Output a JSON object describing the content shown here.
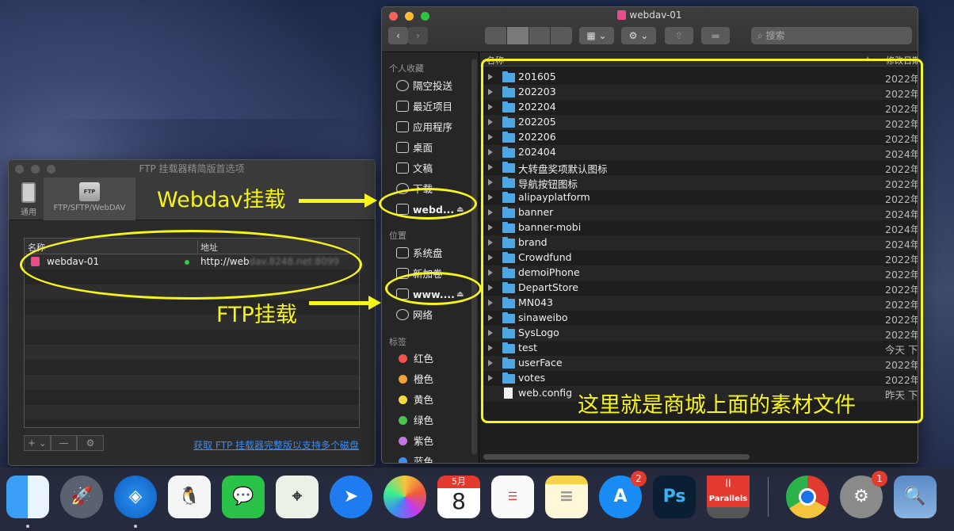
{
  "ftp_window": {
    "title": "FTP 挂载器精简版首选项",
    "tabs": [
      {
        "label": "通用"
      },
      {
        "label": "FTP/SFTP/WebDAV"
      }
    ],
    "table": {
      "col_name": "名称",
      "col_addr": "地址",
      "rows": [
        {
          "name": "webdav-01",
          "addr_visible": "http://web",
          "addr_blurred": "dav.8248.net:8099"
        }
      ]
    },
    "add_btn": "+ ⌄",
    "remove_btn": "—",
    "gear_btn": "⚙",
    "upgrade_link": "获取 FTP 挂载器完整版以支持多个磁盘"
  },
  "finder": {
    "title": "webdav-01",
    "search_placeholder": "搜索",
    "sidebar": {
      "favorites_head": "个人收藏",
      "favorites": [
        "隔空投送",
        "最近项目",
        "应用程序",
        "桌面",
        "文稿",
        "下载"
      ],
      "webdav_item": "webd...",
      "locations_head": "位置",
      "locations": [
        "系统盘",
        "新加卷"
      ],
      "ftp_item": "www....",
      "network": "网络",
      "tags_head": "标签",
      "tags": [
        {
          "name": "红色",
          "color": "#f2524a"
        },
        {
          "name": "橙色",
          "color": "#f5a033"
        },
        {
          "name": "黄色",
          "color": "#f8d93a"
        },
        {
          "name": "绿色",
          "color": "#44c74c"
        },
        {
          "name": "紫色",
          "color": "#c576e0"
        },
        {
          "name": "蓝色",
          "color": "#3c8ef5"
        }
      ]
    },
    "columns": {
      "name": "名称",
      "date": "修改日期"
    },
    "files": [
      {
        "name": "201605",
        "date": "2022年",
        "type": "folder"
      },
      {
        "name": "202203",
        "date": "2022年",
        "type": "folder"
      },
      {
        "name": "202204",
        "date": "2022年",
        "type": "folder"
      },
      {
        "name": "202205",
        "date": "2022年",
        "type": "folder"
      },
      {
        "name": "202206",
        "date": "2022年",
        "type": "folder"
      },
      {
        "name": "202404",
        "date": "2024年",
        "type": "folder"
      },
      {
        "name": "大转盘奖项默认图标",
        "date": "2022年",
        "type": "folder"
      },
      {
        "name": "导航按钮图标",
        "date": "2022年",
        "type": "folder"
      },
      {
        "name": "alipayplatform",
        "date": "2022年",
        "type": "folder"
      },
      {
        "name": "banner",
        "date": "2024年",
        "type": "folder"
      },
      {
        "name": "banner-mobi",
        "date": "2024年",
        "type": "folder"
      },
      {
        "name": "brand",
        "date": "2024年",
        "type": "folder"
      },
      {
        "name": "Crowdfund",
        "date": "2022年",
        "type": "folder"
      },
      {
        "name": "demoiPhone",
        "date": "2022年",
        "type": "folder"
      },
      {
        "name": "DepartStore",
        "date": "2022年",
        "type": "folder"
      },
      {
        "name": "MN043",
        "date": "2022年",
        "type": "folder"
      },
      {
        "name": "sinaweibo",
        "date": "2022年",
        "type": "folder"
      },
      {
        "name": "SysLogo",
        "date": "2022年",
        "type": "folder"
      },
      {
        "name": "test",
        "date": "今天 下午",
        "type": "folder"
      },
      {
        "name": "userFace",
        "date": "2022年",
        "type": "folder"
      },
      {
        "name": "votes",
        "date": "2022年",
        "type": "folder"
      },
      {
        "name": "web.config",
        "date": "昨天 下午",
        "type": "file"
      }
    ]
  },
  "annotations": {
    "webdav": "Webdav挂载",
    "ftp": "FTP挂载",
    "materials": "这里就是商城上面的素材文件"
  },
  "dock": {
    "calendar_month": "5月",
    "calendar_day": "8",
    "appstore_badge": "2",
    "ps_label": "Ps",
    "parallels_label": "|| Parallels",
    "prefs_badge": "1"
  },
  "colors": {
    "annotation": "#f7f41a",
    "folder": "#4ea7e2",
    "link": "#3a8cf0"
  }
}
